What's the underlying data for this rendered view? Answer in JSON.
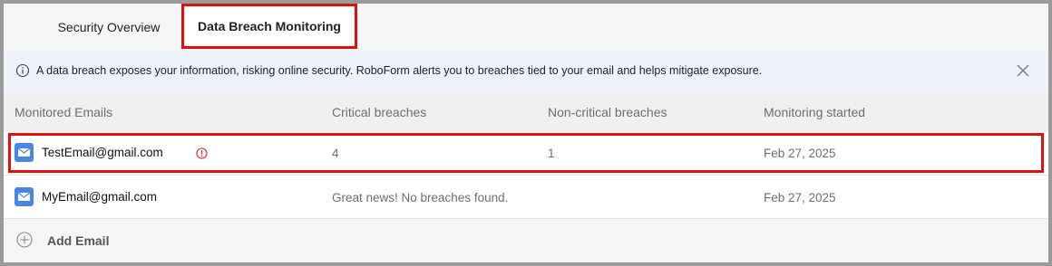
{
  "tabs": {
    "overview_label": "Security Overview",
    "breach_label": "Data Breach Monitoring"
  },
  "banner": {
    "text": "A data breach exposes your information, risking online security. RoboForm alerts you to breaches tied to your email and helps mitigate exposure.",
    "info_icon": "info-icon",
    "close_icon": "close-icon"
  },
  "table": {
    "headers": {
      "email": "Monitored Emails",
      "critical": "Critical breaches",
      "noncritical": "Non-critical breaches",
      "started": "Monitoring started"
    },
    "rows": [
      {
        "email": "TestEmail@gmail.com",
        "critical": "4",
        "noncritical": "1",
        "started": "Feb 27, 2025",
        "alert_icon": "alert-circle-icon"
      },
      {
        "email": "MyEmail@gmail.com",
        "status": "Great news! No breaches found.",
        "started": "Feb 27, 2025"
      }
    ]
  },
  "add_email": {
    "label": "Add Email"
  },
  "colors": {
    "highlight": "#e01010",
    "banner_bg": "#edf2fb",
    "mail_icon": "#4a86e8",
    "alert": "#e02020"
  }
}
